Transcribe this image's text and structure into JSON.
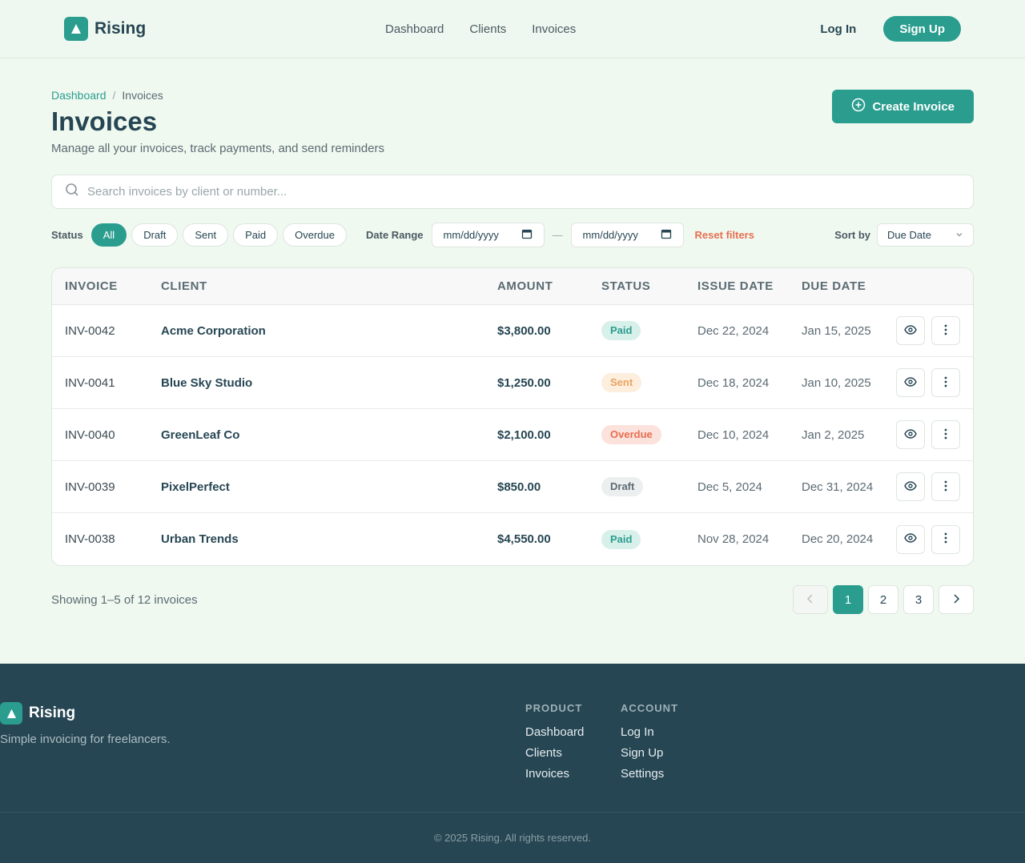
{
  "header": {
    "brand": "Rising",
    "nav": [
      "Dashboard",
      "Clients",
      "Invoices"
    ],
    "login": "Log In",
    "signup": "Sign Up"
  },
  "page": {
    "breadcrumb": [
      "Dashboard",
      "Invoices"
    ],
    "breadcrumb_sep": "/",
    "title": "Invoices",
    "subtitle": "Manage all your invoices, track payments, and send reminders",
    "create_button": "Create Invoice"
  },
  "search": {
    "placeholder": "Search invoices by client or number..."
  },
  "filters": {
    "status_label": "Status",
    "chips": [
      "All",
      "Draft",
      "Sent",
      "Paid",
      "Overdue"
    ],
    "active_chip": "All",
    "date_label": "Date Range",
    "date_from": "mm/dd/yyyy",
    "date_to": "mm/dd/yyyy",
    "date_sep": "—",
    "reset": "Reset filters",
    "sort_label": "Sort by",
    "sort_value": "Due Date"
  },
  "table": {
    "headers": [
      "INVOICE",
      "CLIENT",
      "AMOUNT",
      "STATUS",
      "ISSUE DATE",
      "DUE DATE"
    ],
    "rows": [
      {
        "invoice": "INV-0042",
        "client": "Acme Corporation",
        "amount": "$3,800.00",
        "status": "Paid",
        "issue": "Dec 22, 2024",
        "due": "Jan 15, 2025"
      },
      {
        "invoice": "INV-0041",
        "client": "Blue Sky Studio",
        "amount": "$1,250.00",
        "status": "Sent",
        "issue": "Dec 18, 2024",
        "due": "Jan 10, 2025"
      },
      {
        "invoice": "INV-0040",
        "client": "GreenLeaf Co",
        "amount": "$2,100.00",
        "status": "Overdue",
        "issue": "Dec 10, 2024",
        "due": "Jan 2, 2025"
      },
      {
        "invoice": "INV-0039",
        "client": "PixelPerfect",
        "amount": "$850.00",
        "status": "Draft",
        "issue": "Dec 5, 2024",
        "due": "Dec 31, 2024"
      },
      {
        "invoice": "INV-0038",
        "client": "Urban Trends",
        "amount": "$4,550.00",
        "status": "Paid",
        "issue": "Nov 28, 2024",
        "due": "Dec 20, 2024"
      }
    ]
  },
  "pagination": {
    "showing": "Showing 1–5 of 12 invoices",
    "pages": [
      "1",
      "2",
      "3"
    ],
    "current": "1"
  },
  "footer": {
    "brand": "Rising",
    "tagline": "Simple invoicing for freelancers.",
    "product_heading": "PRODUCT",
    "product_links": [
      "Dashboard",
      "Clients",
      "Invoices"
    ],
    "account_heading": "ACCOUNT",
    "account_links": [
      "Log In",
      "Sign Up",
      "Settings"
    ],
    "copyright": "© 2025 Rising. All rights reserved."
  },
  "colors": {
    "accent": "#2a9d8f",
    "dark": "#264653",
    "warning": "#e76f51",
    "background": "#f0f9f0"
  }
}
